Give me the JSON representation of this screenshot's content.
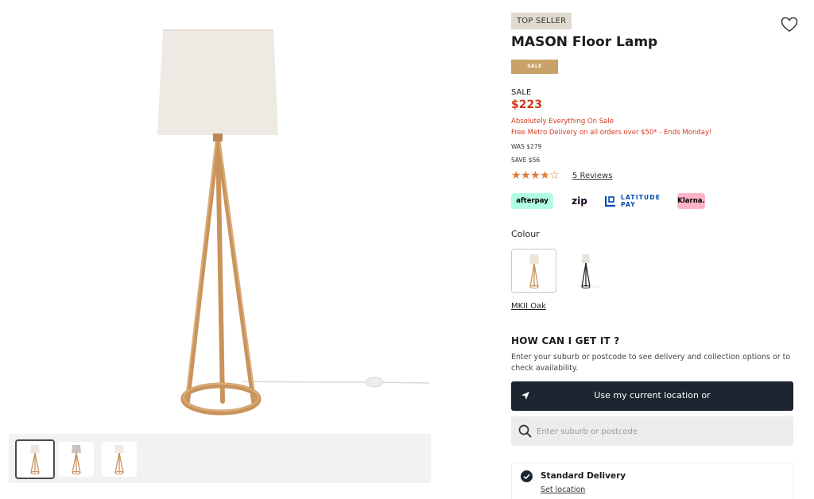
{
  "product": {
    "badge": "TOP SELLER",
    "title": "MASON Floor Lamp",
    "sale_badge": "SALE",
    "sale_label": "SALE",
    "price": "$223",
    "promo_line1": "Absolutely Everything On Sale",
    "promo_line2": "Free Metro Delivery on all orders over $50* - Ends Monday!",
    "was": "WAS $279",
    "save": "SAVE $56",
    "rating": 4,
    "rating_max": 5,
    "reviews": "5 Reviews"
  },
  "payments": {
    "afterpay": "afterpay",
    "zip": "zip",
    "latitude_line1": "LATITUDE",
    "latitude_line2": "PAY",
    "klarna": "Klarna."
  },
  "colour": {
    "label": "Colour",
    "selected_name": "MKII Oak",
    "swatches": [
      "oak-lamp",
      "black-lamp"
    ]
  },
  "availability": {
    "title": "HOW CAN I GET IT ?",
    "description": "Enter your suburb or postcode to see delivery and collection options or to check availability.",
    "location_button": "Use my current location or",
    "search_placeholder": "Enter suburb or postcode",
    "delivery_title": "Standard Delivery",
    "set_location": "Set location"
  },
  "gallery": {
    "thumbnails": [
      "oak-lamp",
      "grey-shade-lamp",
      "cream-shade-lamp"
    ],
    "active_thumbnail": 0
  },
  "colors": {
    "sale_red": "#d1391f",
    "sale_badge": "#c9a26a",
    "dark_button": "#1c2530",
    "star": "#e07b3a",
    "top_seller_bg": "#e1dbcf"
  },
  "icons": {
    "wishlist": "heart-icon",
    "location": "location-arrow-icon",
    "search": "search-icon",
    "check": "check-circle-icon"
  }
}
